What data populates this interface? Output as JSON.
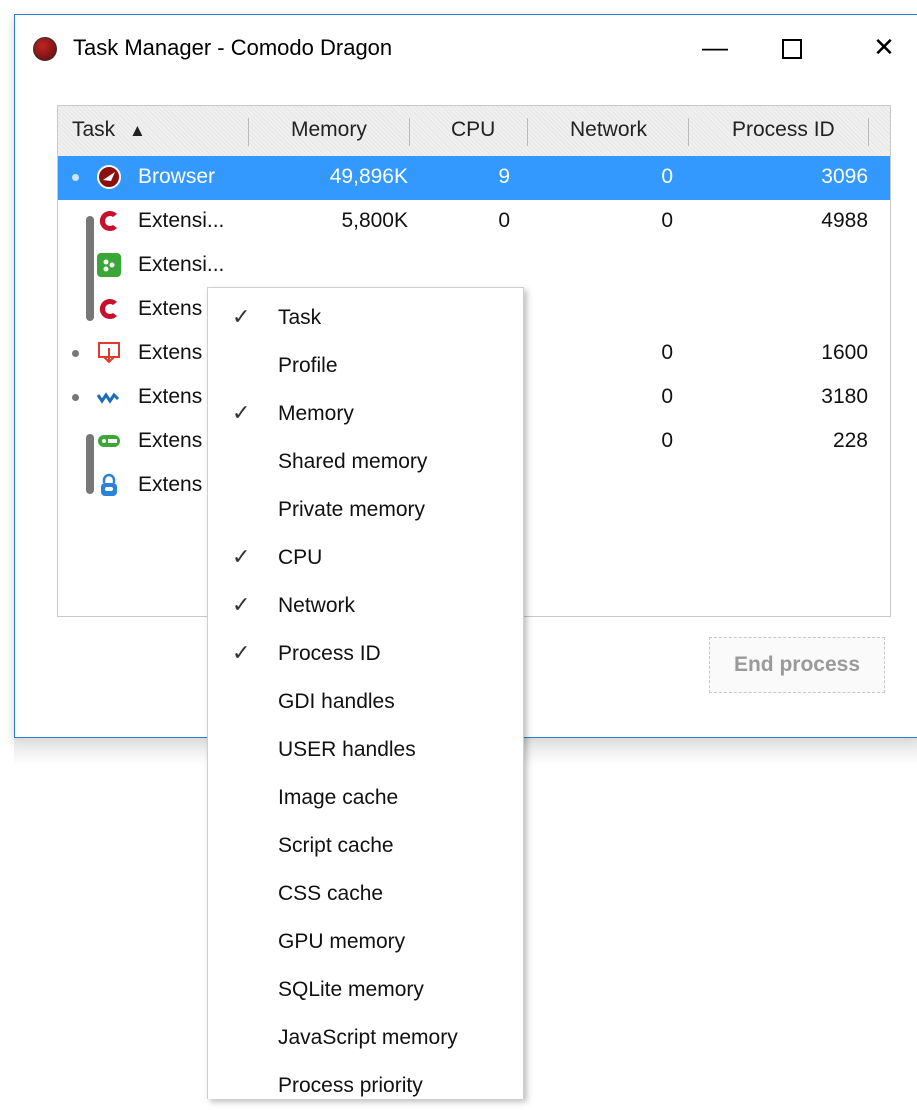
{
  "window": {
    "title": "Task Manager - Comodo Dragon",
    "minimize_glyph": "—",
    "close_glyph": "✕"
  },
  "table": {
    "columns": [
      {
        "label": "Task",
        "sort": "▲"
      },
      {
        "label": "Memory"
      },
      {
        "label": "CPU"
      },
      {
        "label": "Network"
      },
      {
        "label": "Process ID"
      }
    ],
    "rows": [
      {
        "task": "Browser",
        "memory": "49,896K",
        "cpu": "9",
        "network": "0",
        "pid": "3096",
        "selected": true,
        "icon": "comodo-dragon-icon"
      },
      {
        "task": "Extensi...",
        "memory": "5,800K",
        "cpu": "0",
        "network": "0",
        "pid": "4988",
        "icon": "comodo-c-icon"
      },
      {
        "task": "Extensi...",
        "memory": "",
        "cpu": "",
        "network": "",
        "pid": "",
        "icon": "green-puzzle-icon"
      },
      {
        "task": "Extens",
        "memory": "",
        "cpu": "",
        "network": "",
        "pid": "",
        "icon": "comodo-c-icon"
      },
      {
        "task": "Extens",
        "memory": "",
        "cpu": "",
        "network": "0",
        "pid": "1600",
        "icon": "download-icon"
      },
      {
        "task": "Extens",
        "memory": "",
        "cpu": "",
        "network": "0",
        "pid": "3180",
        "icon": "wave-icon"
      },
      {
        "task": "Extens",
        "memory": "",
        "cpu": "",
        "network": "0",
        "pid": "228",
        "icon": "ps-icon"
      },
      {
        "task": "Extens",
        "memory": "",
        "cpu": "",
        "network": "",
        "pid": "",
        "icon": "lock-icon"
      }
    ]
  },
  "end_process_label": "End process",
  "context_menu": {
    "check_glyph": "✓",
    "items": [
      {
        "label": "Task",
        "checked": true
      },
      {
        "label": "Profile",
        "checked": false
      },
      {
        "label": "Memory",
        "checked": true
      },
      {
        "label": "Shared memory",
        "checked": false
      },
      {
        "label": "Private memory",
        "checked": false
      },
      {
        "label": "CPU",
        "checked": true
      },
      {
        "label": "Network",
        "checked": true
      },
      {
        "label": "Process ID",
        "checked": true
      },
      {
        "label": "GDI handles",
        "checked": false
      },
      {
        "label": "USER handles",
        "checked": false
      },
      {
        "label": "Image cache",
        "checked": false
      },
      {
        "label": "Script cache",
        "checked": false
      },
      {
        "label": "CSS cache",
        "checked": false
      },
      {
        "label": "GPU memory",
        "checked": false
      },
      {
        "label": "SQLite memory",
        "checked": false
      },
      {
        "label": "JavaScript memory",
        "checked": false
      },
      {
        "label": "Process priority",
        "checked": false
      }
    ]
  },
  "colors": {
    "selection": "#3399ff",
    "window_border": "#2b7fd6"
  }
}
